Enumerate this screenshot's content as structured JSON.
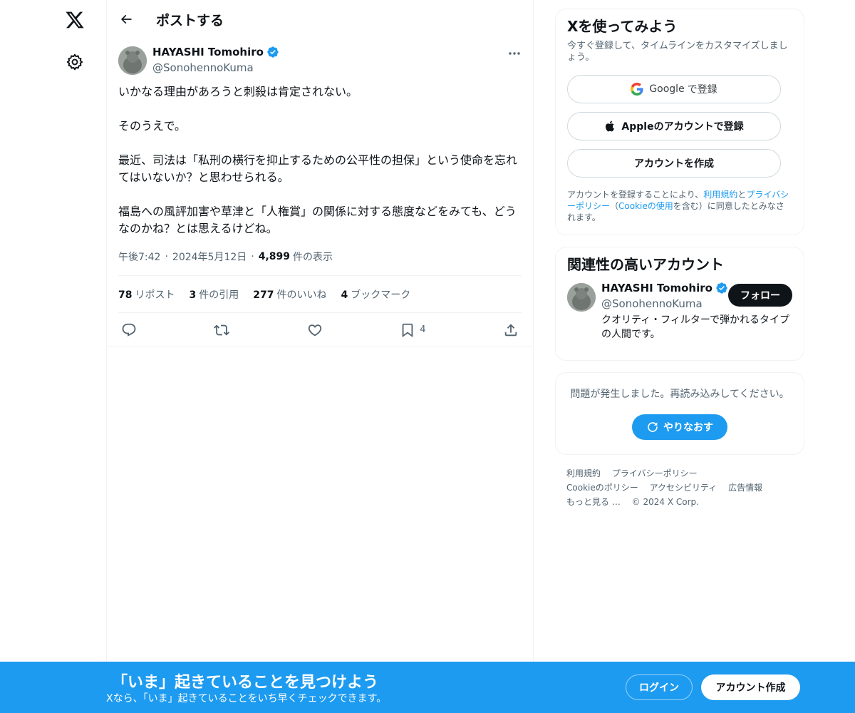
{
  "nav": {
    "logo_icon": "x-logo-icon",
    "settings_icon": "gear-icon"
  },
  "header": {
    "back_icon": "arrow-left-icon",
    "title": "ポストする"
  },
  "tweet": {
    "author_name": "HAYASHI Tomohiro",
    "author_handle": "@SonohennoKuma",
    "verified_icon": "verified-badge-icon",
    "paragraphs": [
      "いかなる理由があろうと刺殺は肯定されない。",
      "そのうえで。",
      "最近、司法は「私刑の横行を抑止するための公平性の担保」という使命を忘れてはいないか？と思わせられる。",
      "福島への風評加害や草津と「人権賞」の関係に対する態度などをみても、どうなのかね？とは思えるけどね。"
    ],
    "time": "午後7:42",
    "date": "2024年5月12日",
    "views": "4,899",
    "views_label": "件の表示",
    "stats": {
      "reposts_num": "78",
      "reposts_label": "リポスト",
      "quotes_num": "3",
      "quotes_label": "件の引用",
      "likes_num": "277",
      "likes_label": "件のいいね",
      "bookmarks_num": "4",
      "bookmarks_label": "ブックマーク"
    },
    "bookmark_count": "4"
  },
  "signup_card": {
    "title": "Xを使ってみよう",
    "subtitle": "今すぐ登録して、タイムラインをカスタマイズしましょう。",
    "google_label_brand": "Google",
    "google_label_rest": "で登録",
    "apple_label": "Appleのアカウントで登録",
    "create_label": "アカウントを作成",
    "legal_1": "アカウントを登録することにより、",
    "legal_terms": "利用規約",
    "legal_2": "と",
    "legal_privacy": "プライバシーポリシー",
    "legal_3": "（",
    "legal_cookie": "Cookieの使用",
    "legal_4": "を含む）に同意したとみなされます。"
  },
  "related_card": {
    "title": "関連性の高いアカウント",
    "name": "HAYASHI Tomohiro",
    "handle": "@SonohennoKuma",
    "bio": "クオリティ・フィルターで弾かれるタイプの人間です。",
    "follow_label": "フォロー"
  },
  "error_card": {
    "message": "問題が発生しました。再読み込みしてください。",
    "retry_label": "やりなおす"
  },
  "footer": {
    "terms": "利用規約",
    "privacy": "プライバシーポリシー",
    "cookie": "Cookieのポリシー",
    "accessibility": "アクセシビリティ",
    "ads": "広告情報",
    "more": "もっと見る …",
    "copyright": "© 2024 X Corp."
  },
  "banner": {
    "title": "「いま」起きていることを見つけよう",
    "subtitle": "Xなら、「いま」起きていることをいち早くチェックできます。",
    "login_label": "ログイン",
    "signup_label": "アカウント作成"
  },
  "colors": {
    "accent": "#1d9bf0",
    "text_primary": "#0f1419",
    "text_secondary": "#536471",
    "border": "#eff3f4"
  }
}
